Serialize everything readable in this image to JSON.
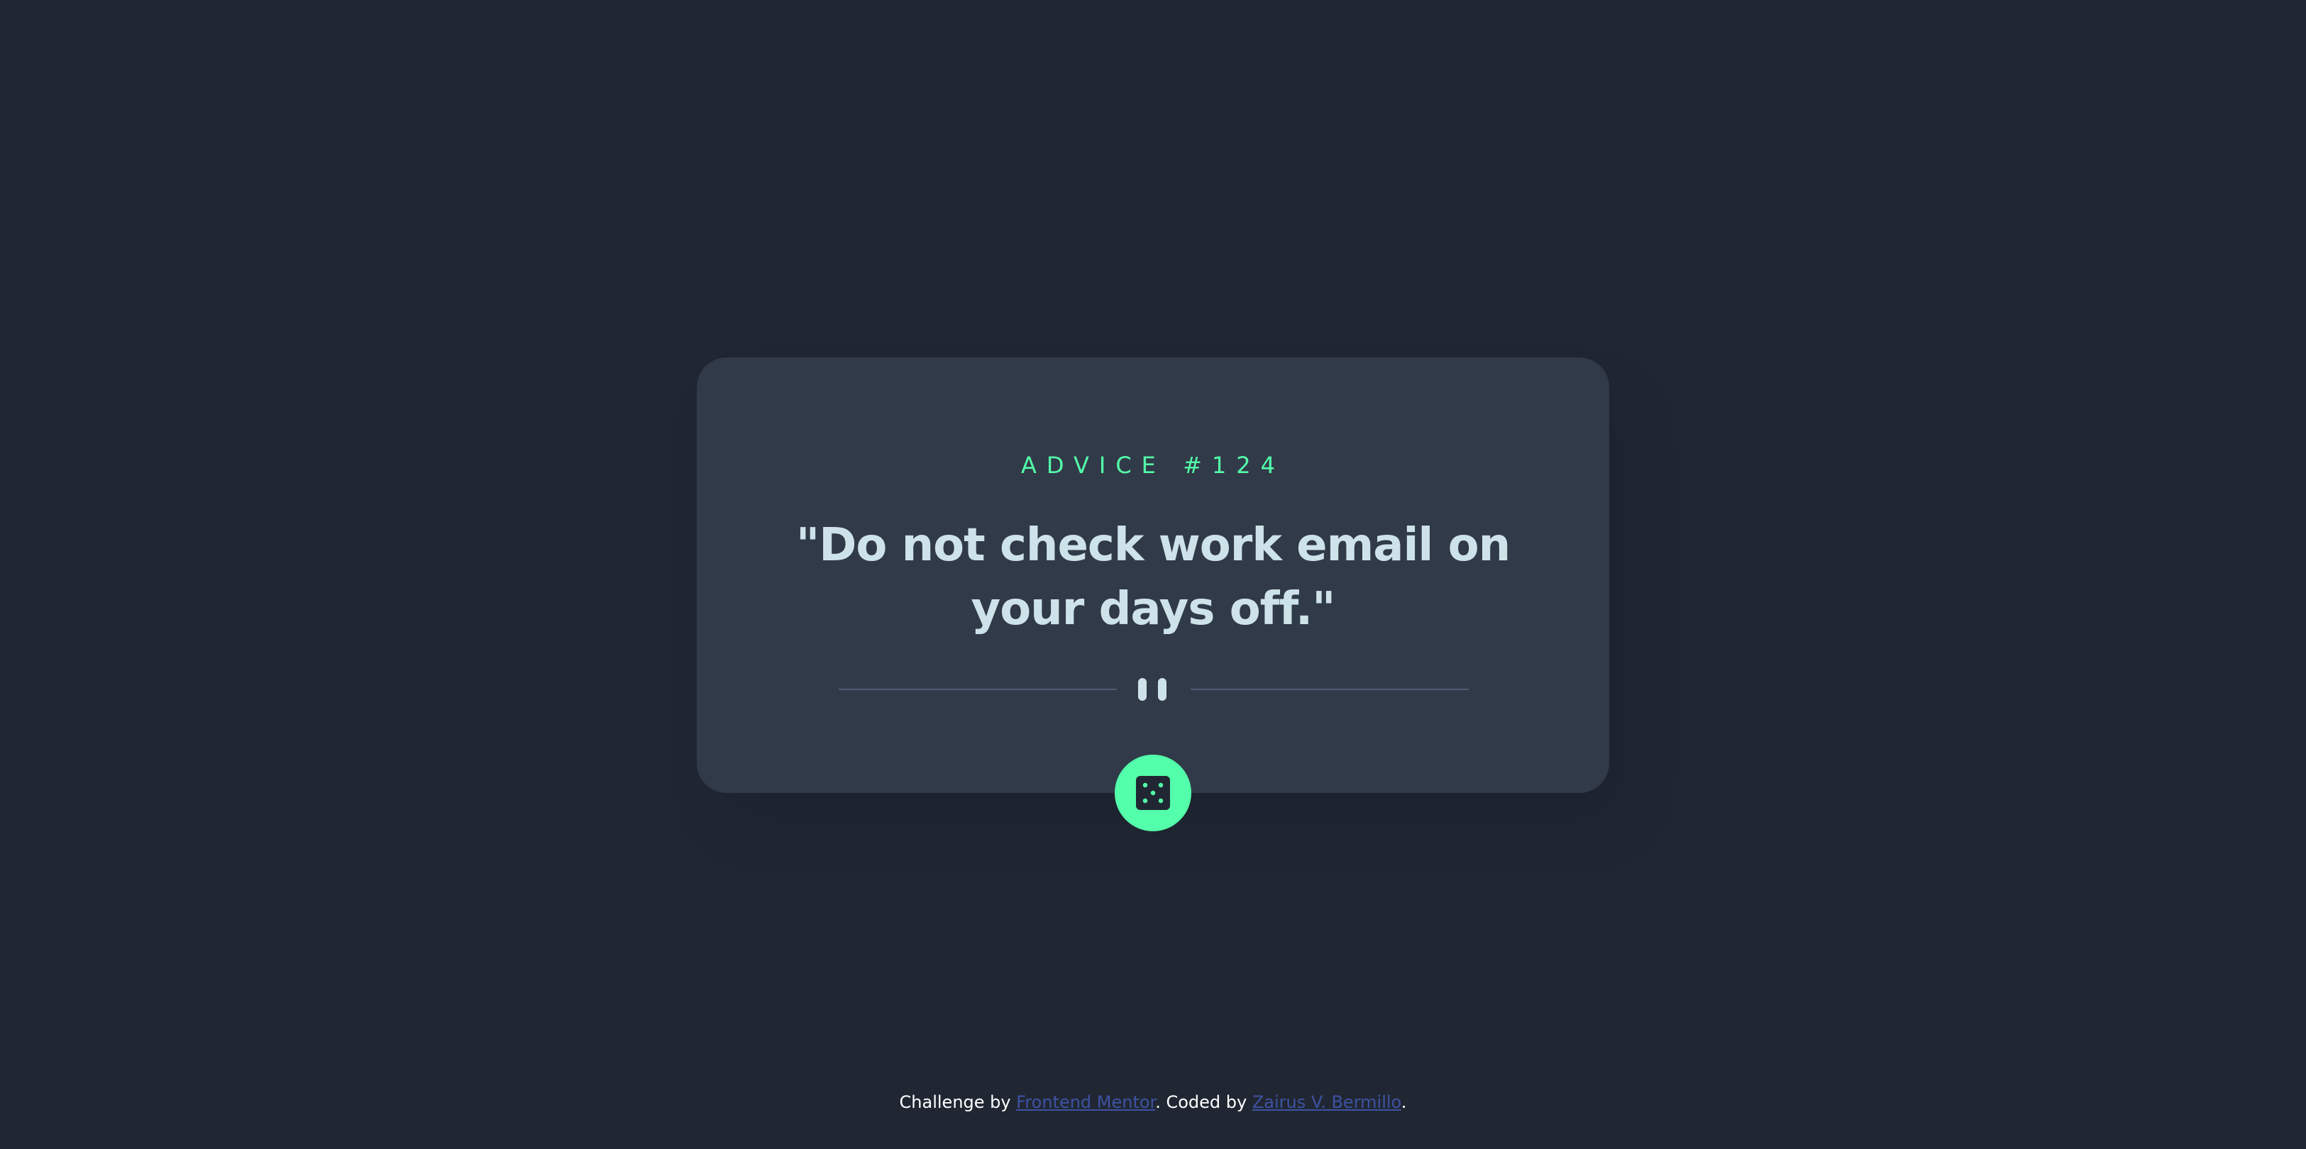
{
  "advice": {
    "label": "ADVICE #124",
    "quote": "\"Do not check work email on your days off.\""
  },
  "divider": {
    "icon": "pause-icon"
  },
  "button": {
    "icon": "dice-icon"
  },
  "footer": {
    "prefix": "Challenge by ",
    "challenge_link": "Frontend Mentor",
    "middle": ". Coded by ",
    "author_link": "Zairus V. Bermillo",
    "suffix": "."
  },
  "colors": {
    "background": "#202733",
    "card": "#313a48",
    "accent": "#53ffaa",
    "text": "#cee3e9",
    "divider": "#4f5d74",
    "link": "#3e52a3"
  }
}
